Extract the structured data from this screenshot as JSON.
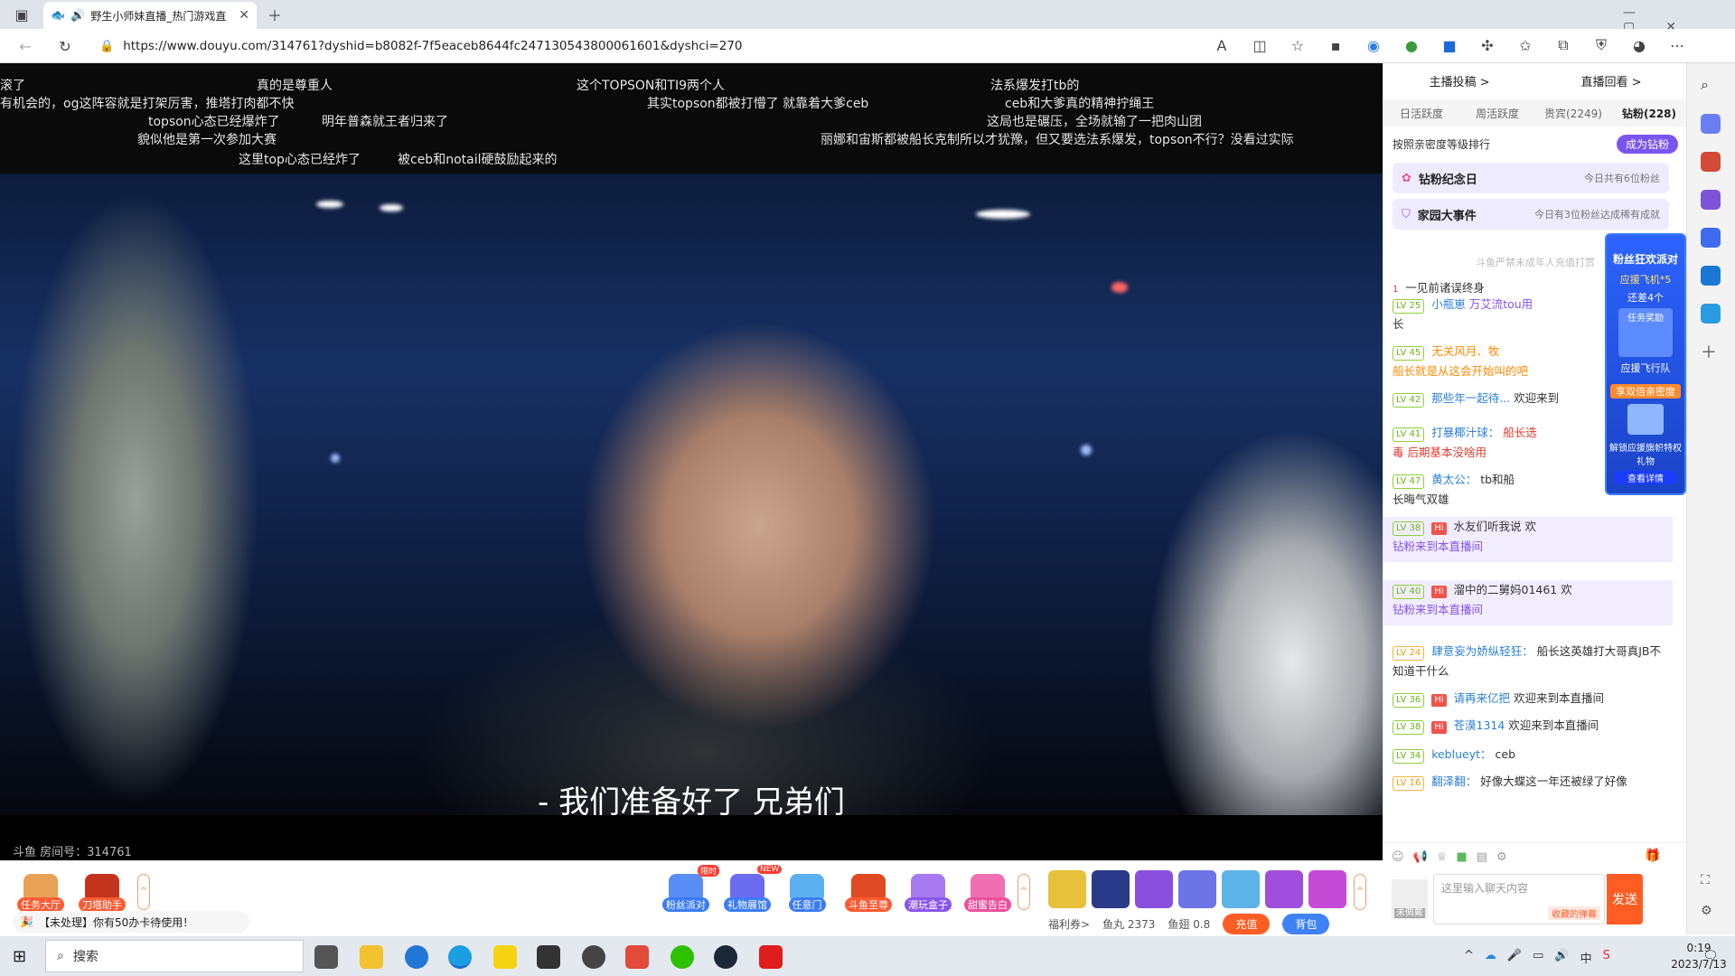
{
  "browser": {
    "tab_title": "野生小师妹直播_热门游戏直",
    "url": "https://www.douyu.com/314761?dyshid=b8082f-7f5eaceb8644fc247130543800061601&dyshci=270"
  },
  "danmu": [
    "滚了",
    "真的是尊重人",
    "这个TOPSON和TI9两个人",
    "法系爆发打tb的",
    "有机会的，og这阵容就是打架厉害，推塔打肉都不快",
    "其实topson都被打懵了 就靠着大爹ceb",
    "ceb和大爹真的精神拧绳王",
    "topson心态已经爆炸了",
    "明年普森就王者归来了",
    "这局也是碾压，全场就输了一把肉山团",
    "貌似他是第一次参加大赛",
    "丽娜和宙斯都被船长克制所以才犹豫，但又要选法系爆发，topson不行？没看过实际",
    "这里top心态已经炸了",
    "被ceb和notail硬鼓励起来的"
  ],
  "video": {
    "subtitle": "- 我们准备好了 兄弟们",
    "room_label": "斗鱼 房间号：314761"
  },
  "bottom": {
    "task_hall": "任务大厅",
    "tower_helper": "刀塔助手",
    "gift_buttons": [
      "粉丝派对",
      "礼物展馆",
      "任意门",
      "斗鱼至尊",
      "潮玩盒子",
      "甜蜜告白"
    ],
    "badges": [
      "限时",
      "NEW"
    ],
    "notice": "【未处理】你有50办卡待使用！",
    "welfare": "福利券>",
    "fish_ball": "鱼丸 2373",
    "fish_fin": "鱼翅 0.8",
    "recharge": "充值",
    "backpack": "背包"
  },
  "panel": {
    "host_submit": "主播投稿 >",
    "replay": "直播回看 >",
    "rank_tabs": [
      "日活跃度",
      "周活跃度",
      "贵宾(2249)",
      "钻粉(228)"
    ],
    "rank_desc": "按照亲密度等级排行",
    "become_fan": "成为钻粉",
    "event1_title": "钻粉纪念日",
    "event1_sub": "今日共有6位粉丝",
    "event2_title": "家园大事件",
    "event2_sub": "今日有3位粉丝达成稀有成就",
    "minor_hint": "斗鱼严禁未成年人充值打赏",
    "promo": [
      "粉丝狂欢派对",
      "应援飞机*5",
      "还差4个",
      "任务奖励",
      "应援飞行队",
      "享双倍亲密度",
      "解锁应援旗帜特权礼物",
      "查看详情"
    ],
    "input_placeholder": "这里输入聊天内容",
    "send": "发送",
    "barrage_style": "收藏的弹幕",
    "unlocked": "未佩戴"
  },
  "chat": [
    {
      "lv": "",
      "name": "一见前诸误终身",
      "text": "",
      "rank": "1"
    },
    {
      "lv": "LV 25",
      "name": "小瓶崽",
      "text": "万艾流tou用",
      "cont": "长"
    },
    {
      "lv": "LV 45",
      "name": "无关风月、牧",
      "text": "",
      "cont": "船长就是从这会开始叫的吧"
    },
    {
      "lv": "LV 42",
      "name": "那些年一起待...",
      "text": "欢迎来到"
    },
    {
      "lv": "LV 41",
      "name": "打暴椰汁球：",
      "text": "船长选",
      "cont": "毒 后期基本没啥用"
    },
    {
      "lv": "LV 47",
      "name": "黄太公：",
      "text": "tb和船",
      "cont": "长晦气双雄"
    },
    {
      "lv": "LV 38",
      "name": "水友们听我说",
      "text": "欢",
      "cont": "钻粉来到本直播间"
    },
    {
      "lv": "LV 40",
      "name": "溜中的二舅妈01461",
      "text": "欢",
      "cont": "钻粉来到本直播间"
    },
    {
      "lv": "LV 24",
      "name": "肆意妄为娇纵轻狂：",
      "text": "船长这英雄打大哥真JB不",
      "cont": "知道干什么"
    },
    {
      "lv": "LV 36",
      "name": "请再来亿把",
      "text": "欢迎来到本直播间"
    },
    {
      "lv": "LV 38",
      "name": "苍漠1314",
      "text": "欢迎来到本直播间"
    },
    {
      "lv": "LV 34",
      "name": "keblueyt：",
      "text": "ceb"
    },
    {
      "lv": "LV 16",
      "name": "翻泽翻：",
      "text": "好像大蝶这一年还被绿了好像"
    }
  ],
  "taskbar": {
    "search": "搜索",
    "time": "0:19",
    "date": "2023/7/13",
    "ime": "中"
  }
}
